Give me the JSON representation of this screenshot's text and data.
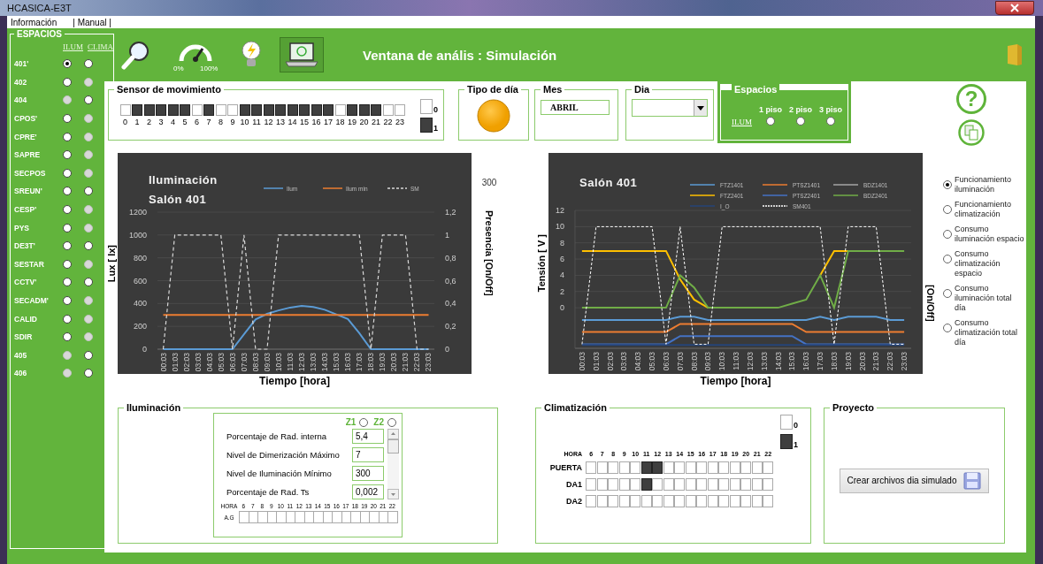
{
  "window": {
    "title": "HCASICA-E3T"
  },
  "menu": [
    {
      "label": "Información"
    },
    {
      "label": "| Manual |"
    }
  ],
  "sidebar": {
    "title": "ESPACIOS",
    "columns": [
      "ILUM",
      "CLIMA"
    ],
    "rows": [
      {
        "label": "401'",
        "ilum": {
          "selected": true,
          "disabled": false
        },
        "clima": {
          "selected": false,
          "disabled": false
        }
      },
      {
        "label": "402",
        "ilum": {
          "selected": false,
          "disabled": false
        },
        "clima": {
          "selected": false,
          "disabled": true
        }
      },
      {
        "label": "404",
        "ilum": {
          "selected": false,
          "disabled": true
        },
        "clima": {
          "selected": false,
          "disabled": false
        }
      },
      {
        "label": "CPOS'",
        "ilum": {
          "selected": false,
          "disabled": false
        },
        "clima": {
          "selected": false,
          "disabled": true
        }
      },
      {
        "label": "CPRE'",
        "ilum": {
          "selected": false,
          "disabled": false
        },
        "clima": {
          "selected": false,
          "disabled": true
        }
      },
      {
        "label": "SAPRE",
        "ilum": {
          "selected": false,
          "disabled": false
        },
        "clima": {
          "selected": false,
          "disabled": true
        }
      },
      {
        "label": "SECPOS",
        "ilum": {
          "selected": false,
          "disabled": false
        },
        "clima": {
          "selected": false,
          "disabled": true
        }
      },
      {
        "label": "SREUN'",
        "ilum": {
          "selected": false,
          "disabled": false
        },
        "clima": {
          "selected": false,
          "disabled": false
        }
      },
      {
        "label": "CESP'",
        "ilum": {
          "selected": false,
          "disabled": false
        },
        "clima": {
          "selected": false,
          "disabled": true
        }
      },
      {
        "label": "PYS",
        "ilum": {
          "selected": false,
          "disabled": false
        },
        "clima": {
          "selected": false,
          "disabled": true
        }
      },
      {
        "label": "DE3T'",
        "ilum": {
          "selected": false,
          "disabled": false
        },
        "clima": {
          "selected": false,
          "disabled": false
        }
      },
      {
        "label": "SESTAR",
        "ilum": {
          "selected": false,
          "disabled": false
        },
        "clima": {
          "selected": false,
          "disabled": true
        }
      },
      {
        "label": "CCTV'",
        "ilum": {
          "selected": false,
          "disabled": false
        },
        "clima": {
          "selected": false,
          "disabled": false
        }
      },
      {
        "label": "SECADM'",
        "ilum": {
          "selected": false,
          "disabled": false
        },
        "clima": {
          "selected": false,
          "disabled": true
        }
      },
      {
        "label": "CALID",
        "ilum": {
          "selected": false,
          "disabled": false
        },
        "clima": {
          "selected": false,
          "disabled": true
        }
      },
      {
        "label": "SDIR",
        "ilum": {
          "selected": false,
          "disabled": false
        },
        "clima": {
          "selected": false,
          "disabled": true
        }
      },
      {
        "label": "405",
        "ilum": {
          "selected": false,
          "disabled": true
        },
        "clima": {
          "selected": false,
          "disabled": false
        }
      },
      {
        "label": "406",
        "ilum": {
          "selected": false,
          "disabled": true
        },
        "clima": {
          "selected": false,
          "disabled": false
        }
      }
    ]
  },
  "toolbar": {
    "tools": [
      {
        "kind": "search",
        "selected": false
      },
      {
        "kind": "gauge",
        "selected": false,
        "labels": [
          "0%",
          "100%"
        ]
      },
      {
        "kind": "bulb",
        "selected": false
      },
      {
        "kind": "laptop",
        "selected": true
      }
    ],
    "title": "Ventana de anális : Simulación"
  },
  "sensor": {
    "title": "Sensor  de movimiento",
    "hours": [
      {
        "label": "0",
        "on": false
      },
      {
        "label": "1",
        "on": true
      },
      {
        "label": "2",
        "on": true
      },
      {
        "label": "3",
        "on": true
      },
      {
        "label": "4",
        "on": true
      },
      {
        "label": "5",
        "on": true
      },
      {
        "label": "6",
        "on": false
      },
      {
        "label": "7",
        "on": true
      },
      {
        "label": "8",
        "on": false
      },
      {
        "label": "9",
        "on": false
      },
      {
        "label": "10",
        "on": true
      },
      {
        "label": "11",
        "on": true
      },
      {
        "label": "12",
        "on": true
      },
      {
        "label": "13",
        "on": true
      },
      {
        "label": "14",
        "on": true
      },
      {
        "label": "15",
        "on": true
      },
      {
        "label": "16",
        "on": true
      },
      {
        "label": "17",
        "on": true
      },
      {
        "label": "18",
        "on": false
      },
      {
        "label": "19",
        "on": true
      },
      {
        "label": "20",
        "on": true
      },
      {
        "label": "21",
        "on": true
      },
      {
        "label": "22",
        "on": false
      },
      {
        "label": "23",
        "on": false
      }
    ],
    "legend": [
      {
        "label": "0",
        "on": false
      },
      {
        "label": "1",
        "on": true
      }
    ]
  },
  "day_type": {
    "title": "Tipo de día"
  },
  "month": {
    "title": "Mes",
    "value": "ABRIL"
  },
  "day": {
    "title": "Dia"
  },
  "spaces": {
    "title": "Espacios",
    "link": "ILUM",
    "options": [
      {
        "label": "1 piso",
        "selected": false
      },
      {
        "label": "2 piso",
        "selected": false
      },
      {
        "label": "3 piso",
        "selected": false
      }
    ]
  },
  "help": {
    "symbol": "?"
  },
  "lighting_chart": {
    "subtitle": "Salón  401",
    "corner_label": "300",
    "y2label": "Presencia [On/Off]",
    "y2_tick_labels": [
      "1,2",
      "1",
      "0,8",
      "0,6",
      "0,4",
      "0,2",
      "0"
    ],
    "chart_data": {
      "type": "line",
      "title": "Iluminación",
      "xlabel": "Tiempo [hora]",
      "ylabel": "Lux [ lx]",
      "grid": true,
      "legend": true,
      "categories": [
        "00:03",
        "01:03",
        "02:03",
        "03:03",
        "04:03",
        "05:03",
        "06:03",
        "07:03",
        "08:03",
        "09:03",
        "10:03",
        "11:03",
        "12:03",
        "13:03",
        "14:03",
        "15:03",
        "16:03",
        "17:03",
        "18:03",
        "19:03",
        "20:03",
        "21:03",
        "22:03",
        "23:03"
      ],
      "ylim": [
        0,
        1200
      ],
      "yticks": [
        0,
        200,
        400,
        600,
        800,
        1000,
        1200
      ],
      "series": [
        {
          "name": "Ilum",
          "color": "#5b9bd5",
          "values": [
            0,
            0,
            0,
            0,
            0,
            0,
            0,
            130,
            260,
            310,
            340,
            365,
            380,
            370,
            345,
            305,
            265,
            140,
            0,
            0,
            0,
            0,
            0,
            0
          ]
        },
        {
          "name": "Ilum min",
          "color": "#ed7d31",
          "values": [
            300,
            300,
            300,
            300,
            300,
            300,
            300,
            300,
            300,
            300,
            300,
            300,
            300,
            300,
            300,
            300,
            300,
            300,
            300,
            300,
            300,
            300,
            300,
            300
          ]
        },
        {
          "name": "SM",
          "color": "#d9d9d9",
          "line_style": "dashed",
          "values": [
            0,
            1000,
            1000,
            1000,
            1000,
            1000,
            0,
            1000,
            0,
            0,
            1000,
            1000,
            1000,
            1000,
            1000,
            1000,
            1000,
            1000,
            0,
            1000,
            1000,
            1000,
            0,
            0
          ]
        }
      ]
    }
  },
  "climate_chart": {
    "y2label": "[On/Off]",
    "chart_data": {
      "type": "line",
      "title": "Salón  401",
      "xlabel": "Tiempo [hora]",
      "ylabel": "Tensión [ V ]",
      "grid": true,
      "legend": true,
      "categories": [
        "00:03",
        "01:03",
        "02:03",
        "03:03",
        "04:03",
        "05:03",
        "06:03",
        "07:03",
        "08:03",
        "09:03",
        "10:03",
        "11:03",
        "12:03",
        "13:03",
        "14:03",
        "15:03",
        "16:03",
        "17:03",
        "18:03",
        "19:03",
        "20:03",
        "21:03",
        "22:03",
        "23:03"
      ],
      "ylim": [
        -5,
        12
      ],
      "yticks": [
        0,
        2,
        4,
        6,
        8,
        10,
        12
      ],
      "series": [
        {
          "name": "FTZ1401",
          "color": "#5b9bd5",
          "values": [
            -1.5,
            -1.5,
            -1.5,
            -1.5,
            -1.5,
            -1.5,
            -1.5,
            -1.1,
            -1.1,
            -1.5,
            -1.5,
            -1.5,
            -1.5,
            -1.5,
            -1.5,
            -1.5,
            -1.5,
            -1.1,
            -1.5,
            -1.1,
            -1.1,
            -1.1,
            -1.5,
            -1.5
          ]
        },
        {
          "name": "PTSZ1401",
          "color": "#ed7d31",
          "values": [
            -3,
            -3,
            -3,
            -3,
            -3,
            -3,
            -3,
            -2,
            -2,
            -2,
            -2,
            -2,
            -2,
            -2,
            -2,
            -2,
            -3,
            -3,
            -3,
            -3,
            -3,
            -3,
            -3,
            -3
          ]
        },
        {
          "name": "BDZ1401",
          "color": "#a5a5a5",
          "values": [
            null,
            null,
            null,
            null,
            null,
            null,
            null,
            null,
            null,
            null,
            null,
            null,
            null,
            null,
            null,
            null,
            null,
            null,
            null,
            null,
            null,
            null,
            null,
            null
          ]
        },
        {
          "name": "FTZ2401",
          "color": "#ffc000",
          "values": [
            7,
            7,
            7,
            7,
            7,
            7,
            7,
            3.5,
            1,
            0,
            null,
            null,
            null,
            null,
            null,
            null,
            null,
            4,
            7,
            7,
            null,
            null,
            null,
            null
          ]
        },
        {
          "name": "PTSZ2401",
          "color": "#4472c4",
          "values": [
            -4.5,
            -4.5,
            -4.5,
            -4.5,
            -4.5,
            -4.5,
            -4.5,
            -3.5,
            -3.5,
            -3.5,
            -3.5,
            -3.5,
            -3.5,
            -3.5,
            -3.5,
            -3.5,
            -4.5,
            -4.5,
            -4.5,
            -4.5,
            -4.5,
            -4.5,
            -4.5,
            -4.5
          ]
        },
        {
          "name": "BDZ2401",
          "color": "#70ad47",
          "values": [
            0,
            0,
            0,
            0,
            0,
            0,
            0,
            4,
            2.5,
            0,
            0,
            0,
            0,
            0,
            0,
            0.5,
            1,
            4,
            0,
            7,
            7,
            7,
            7,
            7
          ]
        },
        {
          "name": "I_O",
          "color": "#264478",
          "values": [
            -4.6,
            -4.6,
            -4.6,
            -4.6,
            -4.6,
            -4.6,
            -4.6,
            -4.6,
            -4.6,
            -4.6,
            -4.6,
            -4.6,
            -4.6,
            -4.6,
            -4.6,
            -4.6,
            -4.6,
            -4.6,
            -4.6,
            -4.6,
            -4.6,
            -4.6,
            -4.6,
            -4.6
          ]
        },
        {
          "name": "SM401",
          "color": "#ffffff",
          "line_style": "dashed",
          "values": [
            -4.5,
            10,
            10,
            10,
            10,
            10,
            -4.5,
            10,
            -4.5,
            -4.5,
            10,
            10,
            10,
            10,
            10,
            10,
            10,
            10,
            -4.5,
            10,
            10,
            10,
            -4.5,
            -4.5
          ]
        }
      ]
    }
  },
  "views": [
    {
      "label": "Funcionamiento iluminación",
      "selected": true
    },
    {
      "label": "Funcionamiento climatización",
      "selected": false
    },
    {
      "label": "Consumo iluminación espacio",
      "selected": false
    },
    {
      "label": "Consumo climatización espacio",
      "selected": false
    },
    {
      "label": "Consumo iluminación total día",
      "selected": false
    },
    {
      "label": "Consumo climatización total día",
      "selected": false
    }
  ],
  "lighting": {
    "title": "Iluminación",
    "zones": [
      {
        "label": "Z1",
        "selected": false
      },
      {
        "label": "Z2",
        "selected": false
      }
    ],
    "params": [
      {
        "label": "Porcentaje de Rad. interna",
        "value": "5,4"
      },
      {
        "label": "Nivel de Dimerización Máximo",
        "value": "7"
      },
      {
        "label": "Nivel de Iluminación Mínimo",
        "value": "300"
      },
      {
        "label": "Porcentaje de Rad. Ts",
        "value": "0,002"
      }
    ],
    "hour_label": "HORA",
    "hours": [
      "6",
      "7",
      "8",
      "9",
      "10",
      "11",
      "12",
      "13",
      "14",
      "15",
      "16",
      "17",
      "18",
      "19",
      "20",
      "21",
      "22"
    ],
    "rows": [
      {
        "label": "A.G",
        "cells": [
          false,
          false,
          false,
          false,
          false,
          false,
          false,
          false,
          false,
          false,
          false,
          false,
          false,
          false,
          false,
          false,
          false
        ]
      }
    ]
  },
  "climate": {
    "title": "Climatización",
    "legend": [
      {
        "label": "0",
        "on": false
      },
      {
        "label": "1",
        "on": true
      }
    ],
    "hour_label": "HORA",
    "hours": [
      "6",
      "7",
      "8",
      "9",
      "10",
      "11",
      "12",
      "13",
      "14",
      "15",
      "16",
      "17",
      "18",
      "19",
      "20",
      "21",
      "22"
    ],
    "rows": [
      {
        "label": "PUERTA",
        "cells": [
          false,
          false,
          false,
          false,
          false,
          true,
          true,
          false,
          false,
          false,
          false,
          false,
          false,
          false,
          false,
          false,
          false
        ]
      },
      {
        "label": "DA1",
        "cells": [
          false,
          false,
          false,
          false,
          false,
          true,
          false,
          false,
          false,
          false,
          false,
          false,
          false,
          false,
          false,
          false,
          false
        ]
      },
      {
        "label": "DA2",
        "cells": [
          false,
          false,
          false,
          false,
          false,
          false,
          false,
          false,
          false,
          false,
          false,
          false,
          false,
          false,
          false,
          false,
          false
        ]
      }
    ]
  },
  "project": {
    "title": "Proyecto",
    "button": "Crear archivos  dia simulado"
  }
}
